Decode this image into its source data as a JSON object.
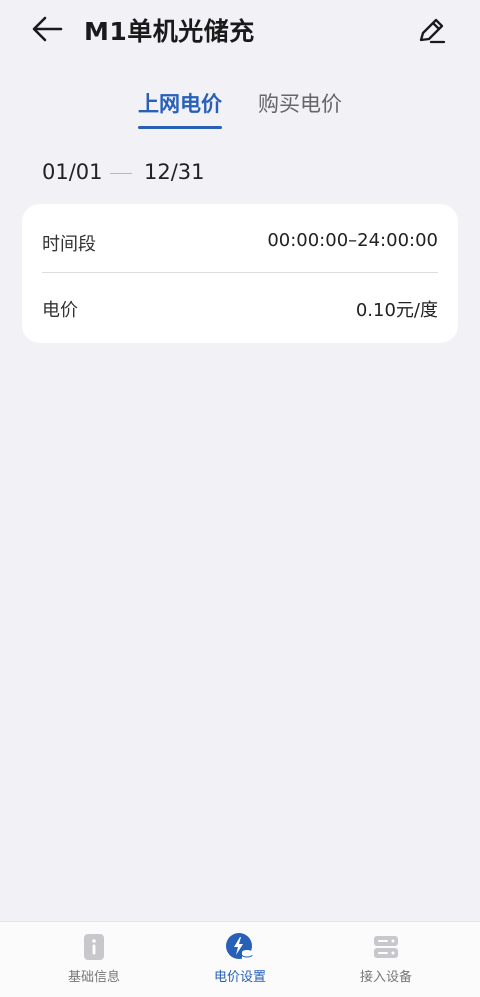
{
  "header": {
    "title": "M1单机光储充",
    "back_icon": "arrow-left-icon",
    "edit_icon": "pencil-icon"
  },
  "tabs": [
    {
      "label": "上网电价",
      "active": true
    },
    {
      "label": "购买电价",
      "active": false
    }
  ],
  "date_range": {
    "start": "01/01",
    "end": "12/31"
  },
  "card": {
    "rows": [
      {
        "label": "时间段",
        "value": "00:00:00–24:00:00"
      },
      {
        "label": "电价",
        "value": "0.10元/度"
      }
    ]
  },
  "bottom_nav": {
    "items": [
      {
        "label": "基础信息",
        "icon": "info-document-icon",
        "active": false
      },
      {
        "label": "电价设置",
        "icon": "electricity-price-icon",
        "active": true
      },
      {
        "label": "接入设备",
        "icon": "server-device-icon",
        "active": false
      }
    ]
  },
  "colors": {
    "accent": "#2860b8",
    "background": "#f1f1f6",
    "card": "#ffffff",
    "inactive_icon": "#c8c8cc"
  }
}
